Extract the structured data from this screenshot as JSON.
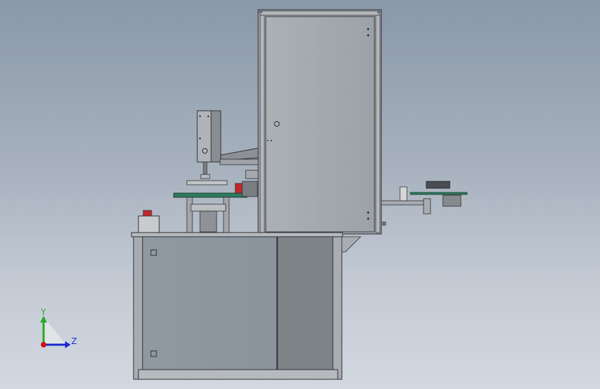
{
  "viewport": {
    "background_top": "#8a98a8",
    "background_bottom": "#d2d8e0"
  },
  "colors": {
    "frame": "#9aa0a6",
    "frame_edge": "#3c3f44",
    "panel": "#a3a8ad",
    "lower_door": "#8d969f",
    "lower_side": "#7e8388",
    "table_top": "#2f7a5e",
    "axis_x": "#d01010",
    "axis_y": "#2aa82a",
    "axis_z": "#1a2ad0"
  },
  "triad": {
    "y_label": "Y",
    "z_label": "Z",
    "x_axis_name": "x-axis",
    "y_axis_name": "y-axis",
    "z_axis_name": "z-axis"
  },
  "icons": [
    "door-handle-icon",
    "hinge-icon",
    "emergency-stop-icon",
    "coordinate-triad-icon"
  ]
}
